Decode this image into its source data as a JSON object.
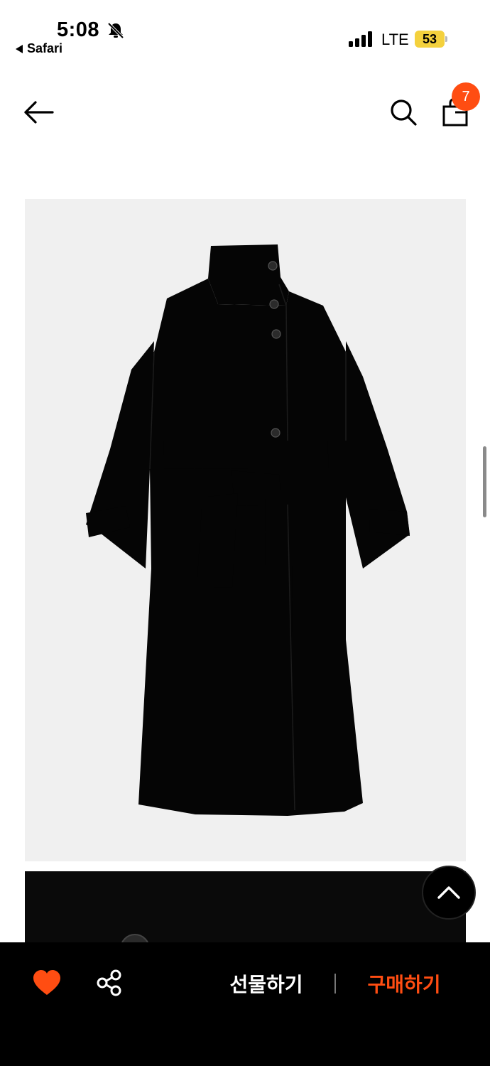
{
  "status_bar": {
    "time": "5:08",
    "back_app": "Safari",
    "network": "LTE",
    "battery": "53"
  },
  "nav": {
    "cart_count": "7"
  },
  "product": {
    "images": [
      "main-black-coat-photo",
      "coat-detail-photo"
    ]
  },
  "actions": {
    "gift_label": "선물하기",
    "buy_label": "구매하기"
  },
  "colors": {
    "accent": "#ff4d12",
    "battery": "#f4d13d",
    "bottom_bar": "#000000"
  }
}
